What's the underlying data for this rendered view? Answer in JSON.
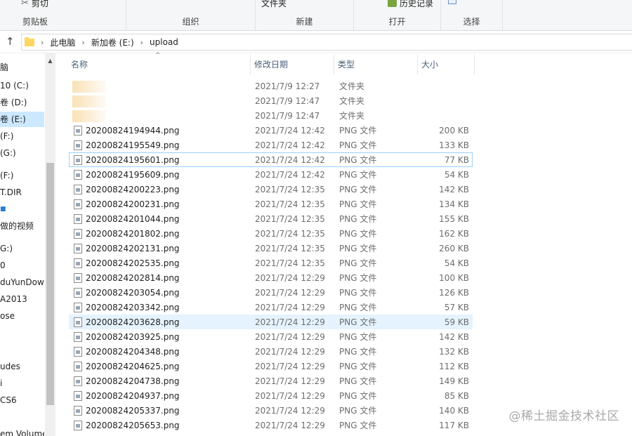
{
  "ribbon": {
    "clipboard": {
      "cut_label": "剪切",
      "group_label": "剪贴板"
    },
    "organize": {
      "group_label": "组织"
    },
    "new": {
      "new_folder_label": "文件夹",
      "group_label": "新建"
    },
    "open": {
      "history_label": "历史记录",
      "group_label": "打开"
    },
    "select": {
      "group_label": "选择"
    }
  },
  "address": {
    "crumbs": [
      "此电脑",
      "新加卷 (E:)",
      "upload"
    ]
  },
  "nav": {
    "items": [
      "脑",
      "10 (C:)",
      "卷 (D:)",
      "卷 (E:)",
      "(F:)",
      "(G:)",
      "(F:)",
      "T.DIR",
      "■",
      "做的视频",
      "G:)",
      "0",
      "duYunDown",
      "A2013",
      "ose",
      "udes",
      "i",
      "CS6",
      "em Volume"
    ]
  },
  "columns": {
    "name": "名称",
    "date": "修改日期",
    "type": "类型",
    "size": "大小"
  },
  "files": [
    {
      "name": "",
      "date": "2021/7/9 12:27",
      "type": "文件夹",
      "size": "",
      "kind": "folder"
    },
    {
      "name": "",
      "date": "2021/7/9 12:47",
      "type": "文件夹",
      "size": "",
      "kind": "folder"
    },
    {
      "name": "",
      "date": "2021/7/9 12:47",
      "type": "文件夹",
      "size": "",
      "kind": "folder"
    },
    {
      "name": "20200824194944.png",
      "date": "2021/7/24 12:42",
      "type": "PNG 文件",
      "size": "200 KB",
      "kind": "png"
    },
    {
      "name": "20200824195549.png",
      "date": "2021/7/24 12:42",
      "type": "PNG 文件",
      "size": "133 KB",
      "kind": "png"
    },
    {
      "name": "20200824195601.png",
      "date": "2021/7/24 12:42",
      "type": "PNG 文件",
      "size": "77 KB",
      "kind": "png"
    },
    {
      "name": "20200824195609.png",
      "date": "2021/7/24 12:42",
      "type": "PNG 文件",
      "size": "54 KB",
      "kind": "png"
    },
    {
      "name": "20200824200223.png",
      "date": "2021/7/24 12:35",
      "type": "PNG 文件",
      "size": "142 KB",
      "kind": "png"
    },
    {
      "name": "20200824200231.png",
      "date": "2021/7/24 12:35",
      "type": "PNG 文件",
      "size": "134 KB",
      "kind": "png"
    },
    {
      "name": "20200824201044.png",
      "date": "2021/7/24 12:35",
      "type": "PNG 文件",
      "size": "155 KB",
      "kind": "png"
    },
    {
      "name": "20200824201802.png",
      "date": "2021/7/24 12:35",
      "type": "PNG 文件",
      "size": "162 KB",
      "kind": "png"
    },
    {
      "name": "20200824202131.png",
      "date": "2021/7/24 12:35",
      "type": "PNG 文件",
      "size": "260 KB",
      "kind": "png"
    },
    {
      "name": "20200824202535.png",
      "date": "2021/7/24 12:35",
      "type": "PNG 文件",
      "size": "54 KB",
      "kind": "png"
    },
    {
      "name": "20200824202814.png",
      "date": "2021/7/24 12:29",
      "type": "PNG 文件",
      "size": "100 KB",
      "kind": "png"
    },
    {
      "name": "20200824203054.png",
      "date": "2021/7/24 12:29",
      "type": "PNG 文件",
      "size": "126 KB",
      "kind": "png"
    },
    {
      "name": "20200824203342.png",
      "date": "2021/7/24 12:29",
      "type": "PNG 文件",
      "size": "57 KB",
      "kind": "png"
    },
    {
      "name": "20200824203628.png",
      "date": "2021/7/24 12:29",
      "type": "PNG 文件",
      "size": "59 KB",
      "kind": "png"
    },
    {
      "name": "20200824203925.png",
      "date": "2021/7/24 12:29",
      "type": "PNG 文件",
      "size": "142 KB",
      "kind": "png"
    },
    {
      "name": "20200824204348.png",
      "date": "2021/7/24 12:29",
      "type": "PNG 文件",
      "size": "132 KB",
      "kind": "png"
    },
    {
      "name": "20200824204625.png",
      "date": "2021/7/24 12:29",
      "type": "PNG 文件",
      "size": "112 KB",
      "kind": "png"
    },
    {
      "name": "20200824204738.png",
      "date": "2021/7/24 12:29",
      "type": "PNG 文件",
      "size": "149 KB",
      "kind": "png"
    },
    {
      "name": "20200824204937.png",
      "date": "2021/7/24 12:29",
      "type": "PNG 文件",
      "size": "85 KB",
      "kind": "png"
    },
    {
      "name": "20200824205337.png",
      "date": "2021/7/24 12:29",
      "type": "PNG 文件",
      "size": "140 KB",
      "kind": "png"
    },
    {
      "name": "20200824205653.png",
      "date": "2021/7/24 12:29",
      "type": "PNG 文件",
      "size": "117 KB",
      "kind": "png"
    }
  ],
  "watermark": "@稀土掘金技术社区"
}
